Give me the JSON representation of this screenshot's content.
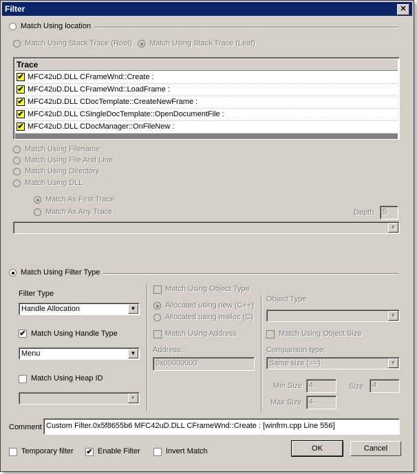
{
  "window": {
    "title": "Filter",
    "close": "✕"
  },
  "location": {
    "match_label": "Match Using location",
    "root_label": "Match Using Stack Trace (Root)",
    "leaf_label": "Match Using Stack Trace (Leaf)",
    "trace_header": "Trace",
    "trace_rows": [
      "MFC42uD.DLL CFrameWnd::Create :",
      "MFC42uD.DLL CFrameWnd::LoadFrame :",
      "MFC42uD.DLL CDocTemplate::CreateNewFrame :",
      "MFC42uD.DLL CSingleDocTemplate::OpenDocumentFile :",
      "MFC42uD.DLL CDocManager::OnFileNew :"
    ],
    "filename_label": "Match Using Filename",
    "fileline_label": "Match Using File And Line",
    "directory_label": "Match Using Directory",
    "dll_label": "Match Using DLL",
    "first_trace_label": "Match As First Trace",
    "any_trace_label": "Match As Any Trace",
    "depth_label": "Depth",
    "depth_value": "5"
  },
  "filter_type": {
    "match_label": "Match Using Filter Type",
    "type_label": "Filter Type",
    "type_value": "Handle Allocation",
    "handle_type_label": "Match Using Handle Type",
    "handle_type_value": "Menu",
    "heap_id_label": "Match Using Heap ID",
    "object_type_check": "Match Using Object Type",
    "alloc_new_label": "Allocated using new (C++)",
    "alloc_malloc_label": "Allocated using malloc (C)",
    "object_type_label": "Object Type",
    "address_check": "Match Using Address",
    "address_label": "Address:",
    "address_value": "0x00000000",
    "object_size_check": "Match Using Object Size",
    "comparison_label": "Comparison type:",
    "comparison_value": "Same size (==)",
    "min_size_label": "Min Size",
    "min_size_value": "4",
    "size_label": "Size",
    "size_value": "4",
    "max_size_label": "Max Size",
    "max_size_value": "4"
  },
  "footer": {
    "comment_label": "Comment",
    "comment_value": "Custom Filter.0x5f8655b6 MFC42uD.DLL CFrameWnd::Create : [winfrm.cpp Line 556]",
    "temporary_label": "Temporary filter",
    "enable_label": "Enable Filter",
    "invert_label": "Invert Match",
    "ok_label": "OK",
    "cancel_label": "Cancel",
    "check_mark": "✔"
  }
}
